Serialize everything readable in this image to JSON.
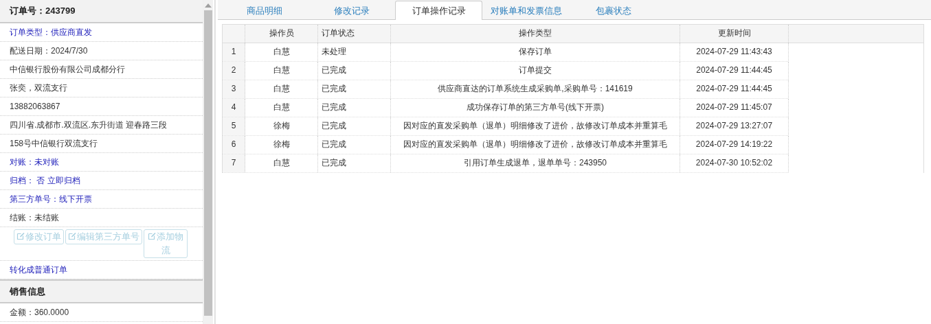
{
  "order_panel": {
    "title": "订单号：243799",
    "rows": [
      {
        "kind": "link",
        "text": "订单类型：供应商直发"
      },
      {
        "kind": "text",
        "text": "配送日期：2024/7/30"
      },
      {
        "kind": "text",
        "text": "中信银行股份有限公司成都分行"
      },
      {
        "kind": "text",
        "text": "张奕，双流支行"
      },
      {
        "kind": "text",
        "text": "13882063867"
      },
      {
        "kind": "text",
        "text": "四川省.成都市.双流区.东升街道 迎春路三段"
      },
      {
        "kind": "text",
        "text": "158号中信银行双流支行"
      },
      {
        "kind": "link",
        "text": "对账：未对账"
      },
      {
        "kind": "link",
        "text": "归档：  否 立即归档"
      },
      {
        "kind": "link",
        "text": "第三方单号：线下开票"
      },
      {
        "kind": "text",
        "text": "结账：未结账"
      }
    ],
    "buttons": [
      {
        "label": "修改订单",
        "disabled": true
      },
      {
        "label": "编辑第三方单号",
        "disabled": true
      },
      {
        "label": "添加物流",
        "disabled": true
      }
    ],
    "convert_link": "转化成普通订单"
  },
  "sales_panel": {
    "title": "销售信息",
    "rows": [
      {
        "text": "金额：360.0000"
      }
    ]
  },
  "tabs": [
    {
      "label": "商品明细",
      "selected": false
    },
    {
      "label": "修改记录",
      "selected": false
    },
    {
      "label": "订单操作记录",
      "selected": true
    },
    {
      "label": "对账单和发票信息",
      "selected": false
    },
    {
      "label": "包裹状态",
      "selected": false
    }
  ],
  "table": {
    "columns": [
      "操作员",
      "订单状态",
      "操作类型",
      "更新时间"
    ],
    "rows": [
      {
        "index": "1",
        "operator": "白慧",
        "status": "未处理",
        "type": "保存订单",
        "time": "2024-07-29 11:43:43"
      },
      {
        "index": "2",
        "operator": "白慧",
        "status": "已完成",
        "type": "订单提交",
        "time": "2024-07-29 11:44:45"
      },
      {
        "index": "3",
        "operator": "白慧",
        "status": "已完成",
        "type": "供应商直达的订单系统生成采购单,采购单号：141619",
        "time": "2024-07-29 11:44:45"
      },
      {
        "index": "4",
        "operator": "白慧",
        "status": "已完成",
        "type": "成功保存订单的第三方单号(线下开票)",
        "time": "2024-07-29 11:45:07"
      },
      {
        "index": "5",
        "operator": "徐梅",
        "status": "已完成",
        "type": "因对应的直发采购单（退单）明细修改了进价，故修改订单成本并重算毛",
        "time": "2024-07-29 13:27:07"
      },
      {
        "index": "6",
        "operator": "徐梅",
        "status": "已完成",
        "type": "因对应的直发采购单（退单）明细修改了进价，故修改订单成本并重算毛",
        "time": "2024-07-29 14:19:22"
      },
      {
        "index": "7",
        "operator": "白慧",
        "status": "已完成",
        "type": "引用订单生成退单，退单单号：243950",
        "time": "2024-07-30 10:52:02"
      }
    ]
  }
}
